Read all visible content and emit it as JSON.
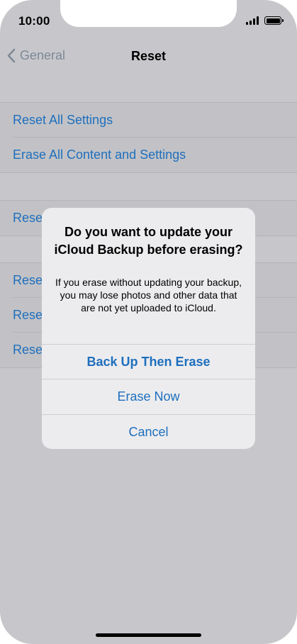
{
  "status_bar": {
    "time": "10:00"
  },
  "navbar": {
    "back_label": "General",
    "title": "Reset"
  },
  "settings": {
    "group1": [
      "Reset All Settings",
      "Erase All Content and Settings"
    ],
    "group2": [
      "Rese"
    ],
    "group3": [
      "Rese",
      "Rese",
      "Rese"
    ]
  },
  "alert": {
    "title": "Do you want to update your iCloud Backup before erasing?",
    "message": "If you erase without updating your backup, you may lose photos and other data that are not yet uploaded to iCloud.",
    "buttons": [
      "Back Up Then Erase",
      "Erase Now",
      "Cancel"
    ]
  },
  "colors": {
    "accent": "#1e6fbd",
    "dim_background": "#c7c7cb",
    "alert_background": "#ececee"
  }
}
